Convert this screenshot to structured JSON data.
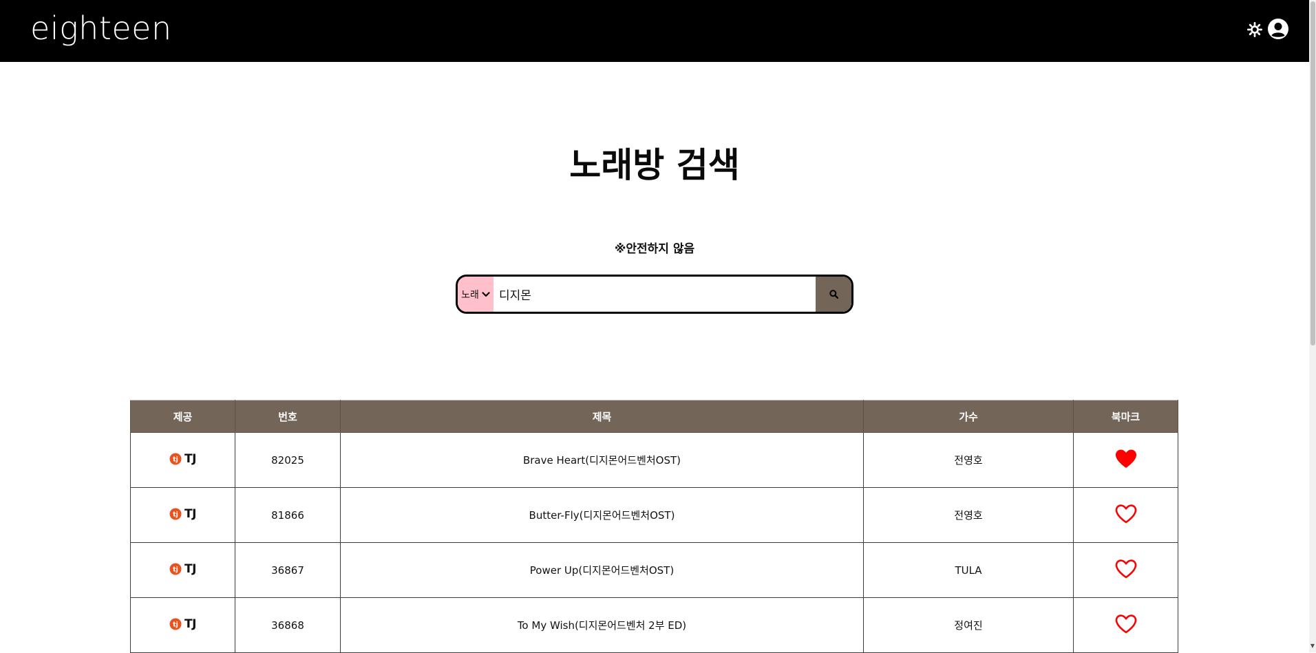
{
  "header": {
    "logo_text": "eighteen",
    "theme_icon": "sun-gear-icon",
    "account_icon": "user-circle-icon"
  },
  "page": {
    "title": "노래방 검색",
    "notice": "※안전하지 않음"
  },
  "search": {
    "category_selected": "노래",
    "query_value": "디지몬",
    "button_icon": "search-icon",
    "select_color": "#ffc0cb",
    "button_color": "#736558"
  },
  "table": {
    "header_color": "#736558",
    "columns": [
      "제공",
      "번호",
      "제목",
      "가수",
      "북마크"
    ],
    "rows": [
      {
        "provider": "TJ",
        "number": "82025",
        "title": "Brave Heart(디지몬어드벤처OST)",
        "artist": "전영호",
        "bookmarked": true
      },
      {
        "provider": "TJ",
        "number": "81866",
        "title": "Butter-Fly(디지몬어드벤처OST)",
        "artist": "전영호",
        "bookmarked": false
      },
      {
        "provider": "TJ",
        "number": "36867",
        "title": "Power Up(디지몬어드벤처OST)",
        "artist": "TULA",
        "bookmarked": false
      },
      {
        "provider": "TJ",
        "number": "36868",
        "title": "To My Wish(디지몬어드벤처 2부 ED)",
        "artist": "정여진",
        "bookmarked": false
      }
    ]
  },
  "colors": {
    "bookmark_heart": "#ff0000",
    "tj_logo": "#e8531f"
  }
}
